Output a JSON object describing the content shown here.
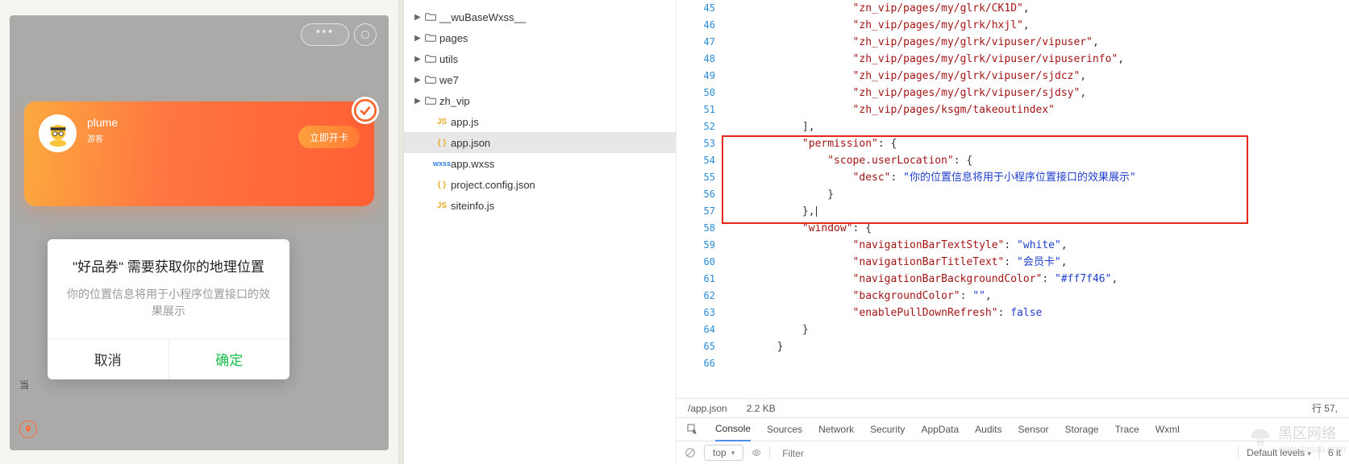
{
  "simulator": {
    "user_name": "plume",
    "user_sub": "游客",
    "open_card": "立即开卡",
    "cur_label": "当",
    "dialog": {
      "title": "\"好品券\" 需要获取你的地理位置",
      "desc": "你的位置信息将用于小程序位置接口的效果展示",
      "cancel": "取消",
      "ok": "确定"
    }
  },
  "tree": {
    "items": [
      {
        "type": "folder",
        "label": "__wuBaseWxss__",
        "expandable": true,
        "level": 0
      },
      {
        "type": "folder",
        "label": "pages",
        "expandable": true,
        "level": 0
      },
      {
        "type": "folder",
        "label": "utils",
        "expandable": true,
        "level": 0
      },
      {
        "type": "folder",
        "label": "we7",
        "expandable": true,
        "level": 0
      },
      {
        "type": "folder",
        "label": "zh_vip",
        "expandable": true,
        "level": 0
      },
      {
        "type": "file",
        "icon": "js",
        "label": "app.js",
        "level": 1
      },
      {
        "type": "file",
        "icon": "json",
        "label": "app.json",
        "level": 1,
        "selected": true
      },
      {
        "type": "file",
        "icon": "wxss",
        "label": "app.wxss",
        "level": 1
      },
      {
        "type": "file",
        "icon": "json",
        "label": "project.config.json",
        "level": 1
      },
      {
        "type": "file",
        "icon": "js",
        "label": "siteinfo.js",
        "level": 1
      }
    ]
  },
  "editor": {
    "first_line_no": 45,
    "lines": [
      [
        [
          "sp",
          20
        ],
        [
          "str",
          "\"zn_vip/pages/my/glrk/CK1D\""
        ],
        [
          "p",
          ","
        ]
      ],
      [
        [
          "sp",
          20
        ],
        [
          "str",
          "\"zh_vip/pages/my/glrk/hxjl\""
        ],
        [
          "p",
          ","
        ]
      ],
      [
        [
          "sp",
          20
        ],
        [
          "str",
          "\"zh_vip/pages/my/glrk/vipuser/vipuser\""
        ],
        [
          "p",
          ","
        ]
      ],
      [
        [
          "sp",
          20
        ],
        [
          "str",
          "\"zh_vip/pages/my/glrk/vipuser/vipuserinfo\""
        ],
        [
          "p",
          ","
        ]
      ],
      [
        [
          "sp",
          20
        ],
        [
          "str",
          "\"zh_vip/pages/my/glrk/vipuser/sjdcz\""
        ],
        [
          "p",
          ","
        ]
      ],
      [
        [
          "sp",
          20
        ],
        [
          "str",
          "\"zh_vip/pages/my/glrk/vipuser/sjdsy\""
        ],
        [
          "p",
          ","
        ]
      ],
      [
        [
          "sp",
          20
        ],
        [
          "str",
          "\"zh_vip/pages/ksgm/takeoutindex\""
        ]
      ],
      [
        [
          "sp",
          12
        ],
        [
          "p",
          "],"
        ]
      ],
      [
        [
          "sp",
          12
        ],
        [
          "key",
          "\"permission\""
        ],
        [
          "p",
          ": {"
        ]
      ],
      [
        [
          "sp",
          16
        ],
        [
          "key",
          "\"scope.userLocation\""
        ],
        [
          "p",
          ": {"
        ]
      ],
      [
        [
          "sp",
          20
        ],
        [
          "key",
          "\"desc\""
        ],
        [
          "p",
          ": "
        ],
        [
          "strblue",
          "\"你的位置信息将用于小程序位置接口的效果展示\""
        ]
      ],
      [
        [
          "sp",
          16
        ],
        [
          "p",
          "}"
        ]
      ],
      [
        [
          "sp",
          12
        ],
        [
          "p",
          "},"
        ],
        [
          "cursor"
        ]
      ],
      [
        [
          "sp",
          12
        ],
        [
          "key",
          "\"window\""
        ],
        [
          "p",
          ": {"
        ]
      ],
      [
        [
          "sp",
          20
        ],
        [
          "key",
          "\"navigationBarTextStyle\""
        ],
        [
          "p",
          ": "
        ],
        [
          "strblue",
          "\"white\""
        ],
        [
          "p",
          ","
        ]
      ],
      [
        [
          "sp",
          20
        ],
        [
          "key",
          "\"navigationBarTitleText\""
        ],
        [
          "p",
          ": "
        ],
        [
          "strblue",
          "\"会员卡\""
        ],
        [
          "p",
          ","
        ]
      ],
      [
        [
          "sp",
          20
        ],
        [
          "key",
          "\"navigationBarBackgroundColor\""
        ],
        [
          "p",
          ": "
        ],
        [
          "strblue",
          "\"#ff7f46\""
        ],
        [
          "p",
          ","
        ]
      ],
      [
        [
          "sp",
          20
        ],
        [
          "key",
          "\"backgroundColor\""
        ],
        [
          "p",
          ": "
        ],
        [
          "strblue",
          "\"\""
        ],
        [
          "p",
          ","
        ]
      ],
      [
        [
          "sp",
          20
        ],
        [
          "key",
          "\"enablePullDownRefresh\""
        ],
        [
          "p",
          ": "
        ],
        [
          "bool",
          "false"
        ]
      ],
      [
        [
          "sp",
          12
        ],
        [
          "p",
          "}"
        ]
      ],
      [
        [
          "sp",
          8
        ],
        [
          "p",
          "}"
        ]
      ],
      []
    ],
    "status_path": "/app.json",
    "status_size": "2.2 KB",
    "status_pos": "行 57,"
  },
  "devtools": {
    "tabs": [
      "Console",
      "Sources",
      "Network",
      "Security",
      "AppData",
      "Audits",
      "Sensor",
      "Storage",
      "Trace",
      "Wxml"
    ],
    "active": 0,
    "strip": {
      "context": "top",
      "filter_placeholder": "Filter",
      "levels": "Default levels",
      "hidden": "6 it"
    }
  },
  "watermark": {
    "name": "黑区网络",
    "url": "www.heiqu.com"
  }
}
